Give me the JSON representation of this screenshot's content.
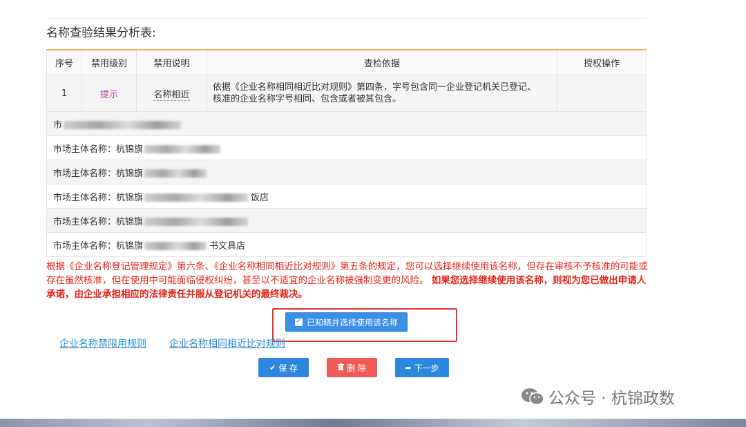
{
  "heading": "名称查验结果分析表:",
  "table": {
    "headers": [
      "序号",
      "禁用级别",
      "禁用说明",
      "查检依据",
      "授权操作"
    ],
    "rule_row": {
      "index": "1",
      "level": "提示",
      "description": "名称相近",
      "basis_line1": "依据《企业名称相同相近比对规则》第四条，字号包含同一企业登记机关已登记、",
      "basis_line2": "核准的企业名称字号相同、包含或者被其包含。",
      "operation": ""
    },
    "entity_label": "市场主体名称：",
    "entities": [
      {
        "prefix": "市",
        "suffix": ""
      },
      {
        "prefix": "杭锦旗",
        "suffix": ""
      },
      {
        "prefix": "杭锦旗",
        "suffix": ""
      },
      {
        "prefix": "杭锦旗",
        "suffix": "饭店"
      },
      {
        "prefix": "杭锦旗",
        "suffix": ""
      },
      {
        "prefix": "杭锦旗",
        "suffix": "书文具店"
      }
    ]
  },
  "notice": {
    "normal": "根据《企业名称登记管理规定》第六条、《企业名称相同相近比对规则》第五条的规定，您可以选择继续使用该名称，但存在审核不予核准的可能或存在虽然核准，但在使用中可能面临侵权纠纷，甚至以不适宜的企业名称被强制变更的风险。",
    "bold": "如果您选择继续使用该名称，则视为您已做出申请人承诺，由企业承担相应的法律责任并服从登记机关的最终裁决。"
  },
  "ack_button": "已知晓并选择使用该名称",
  "links": {
    "restricted_rules": "企业名称禁限用规则",
    "similar_rules": "企业名称相同相近比对规则"
  },
  "buttons": {
    "save": "保 存",
    "delete": "删 除",
    "next": "下一步"
  },
  "watermark": "公众号 · 杭锦政数",
  "colors": {
    "accent_blue": "#2e87df",
    "danger_red": "#ef5c56",
    "notice_red": "#e8231a",
    "hint_purple": "#b03aa3",
    "table_top_border": "#f5b04a"
  },
  "icons": {
    "save": "check-icon",
    "delete": "trash-icon",
    "next": "share-forward-icon",
    "ack": "checkbox-checked-icon",
    "watermark": "wechat-icon"
  }
}
